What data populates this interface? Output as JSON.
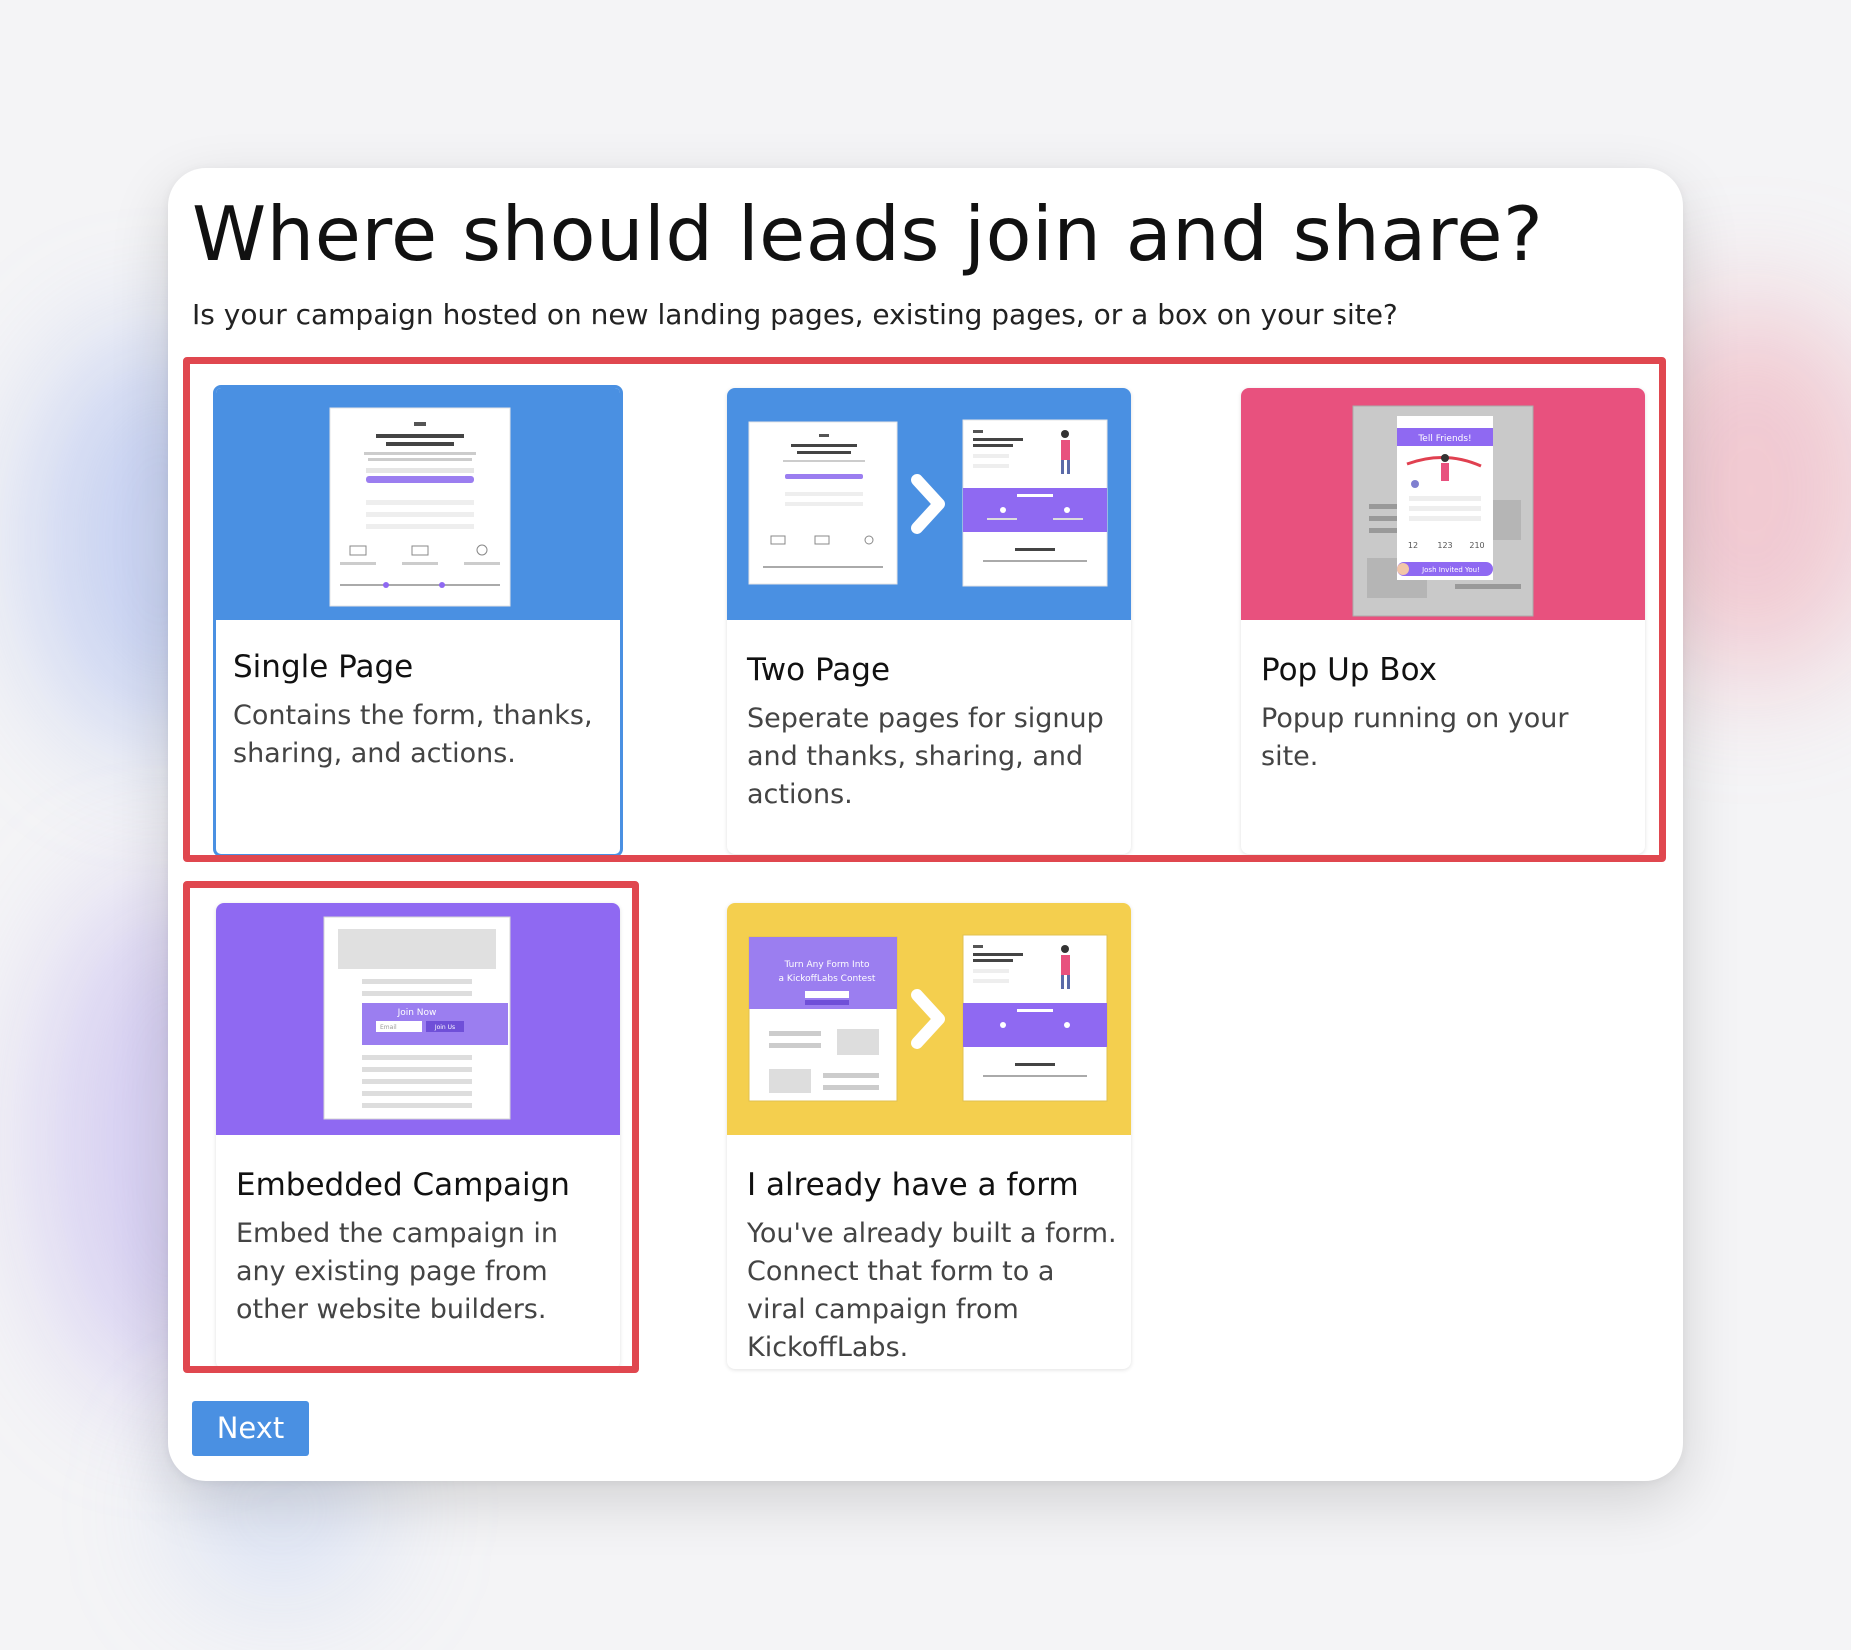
{
  "page": {
    "title": "Where should leads join and share?",
    "subtitle": "Is your campaign hosted on new landing pages, existing pages, or a box on your site?"
  },
  "options": [
    {
      "title": "Single Page",
      "description": "Contains the form, thanks, sharing, and actions.",
      "selected": true,
      "thumb_color": "#4a90e2",
      "illustration": "single-page-preview"
    },
    {
      "title": "Two Page",
      "description": "Seperate pages for signup and thanks, sharing, and actions.",
      "selected": false,
      "thumb_color": "#4a90e2",
      "illustration": "two-page-preview"
    },
    {
      "title": "Pop Up Box",
      "description": "Popup running on your site.",
      "selected": false,
      "thumb_color": "#e8517e",
      "illustration": "popup-preview"
    },
    {
      "title": "Embedded Campaign",
      "description": "Embed the campaign in any existing page from other website builders.",
      "selected": false,
      "thumb_color": "#8f69f2",
      "illustration": "embedded-preview"
    },
    {
      "title": "I already have a form",
      "description": "You've already built a form. Connect that form to a viral campaign from KickoffLabs.",
      "selected": false,
      "thumb_color": "#f4cf4e",
      "illustration": "existing-form-preview"
    }
  ],
  "thumb_text": {
    "popup_header": "Tell Friends!",
    "popup_stats": [
      "12",
      "123",
      "210"
    ],
    "popup_invite": "Josh Invited You!",
    "embed_join": "Join Now",
    "embed_email": "Email",
    "embed_btn": "Join Us",
    "form_headline": [
      "Turn Any Form Into",
      "a KickoffLabs Contest"
    ]
  },
  "footer": {
    "next_label": "Next"
  },
  "colors": {
    "accent": "#4a90e2",
    "highlight": "#e0474f"
  }
}
